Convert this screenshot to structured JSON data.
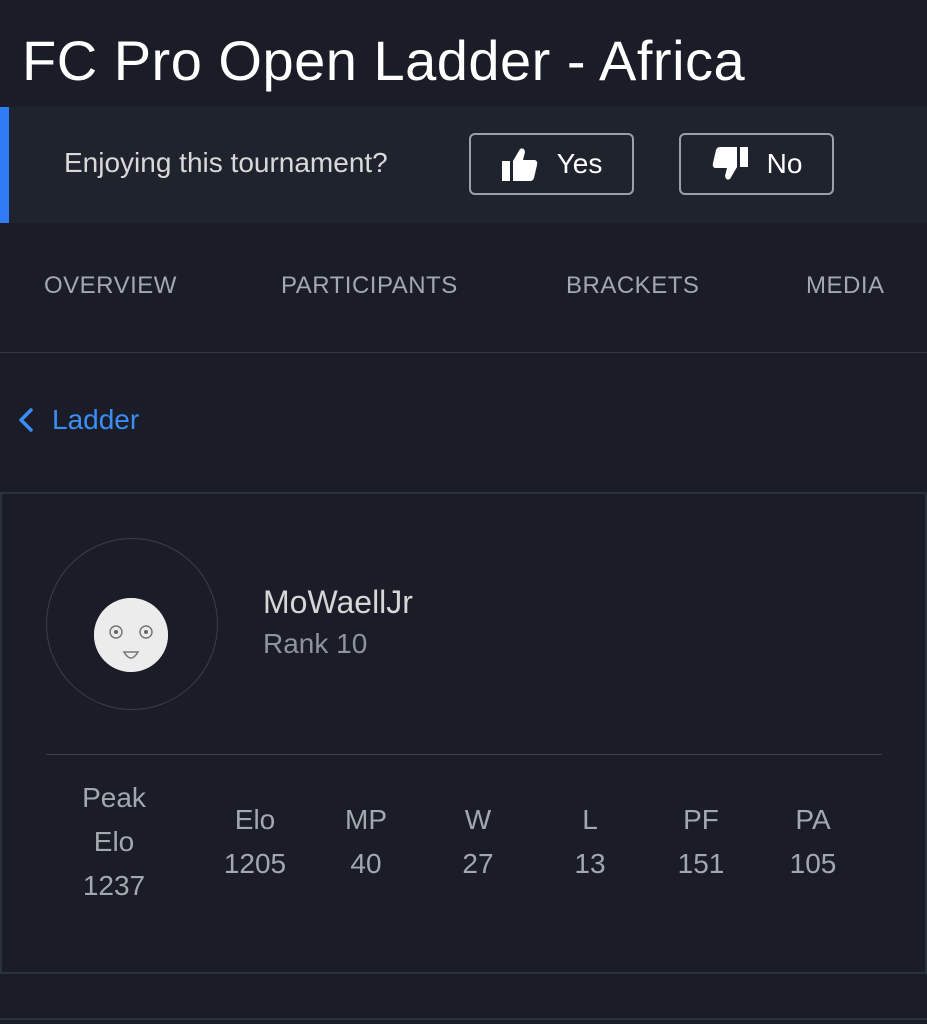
{
  "header": {
    "title": "FC Pro Open Ladder - Africa"
  },
  "feedback": {
    "question": "Enjoying this tournament?",
    "yes_label": "Yes",
    "no_label": "No",
    "yes_icon": "thumbs-up-icon",
    "no_icon": "thumbs-down-icon",
    "accent_color": "#2f7cf6"
  },
  "tabs": [
    {
      "label": "OVERVIEW"
    },
    {
      "label": "PARTICIPANTS"
    },
    {
      "label": "BRACKETS"
    },
    {
      "label": "MEDIA"
    }
  ],
  "back_link": {
    "label": "Ladder",
    "icon": "chevron-left-icon",
    "color": "#3b8df5"
  },
  "player": {
    "name": "MoWaellJr",
    "rank": "Rank 10",
    "avatar_icon": "smiley-face-icon"
  },
  "stats": [
    {
      "label_line1": "Peak",
      "label_line2": "Elo",
      "value": "1237"
    },
    {
      "label": "Elo",
      "value": "1205"
    },
    {
      "label": "MP",
      "value": "40"
    },
    {
      "label": "W",
      "value": "27"
    },
    {
      "label": "L",
      "value": "13"
    },
    {
      "label": "PF",
      "value": "151"
    },
    {
      "label": "PA",
      "value": "105"
    }
  ]
}
